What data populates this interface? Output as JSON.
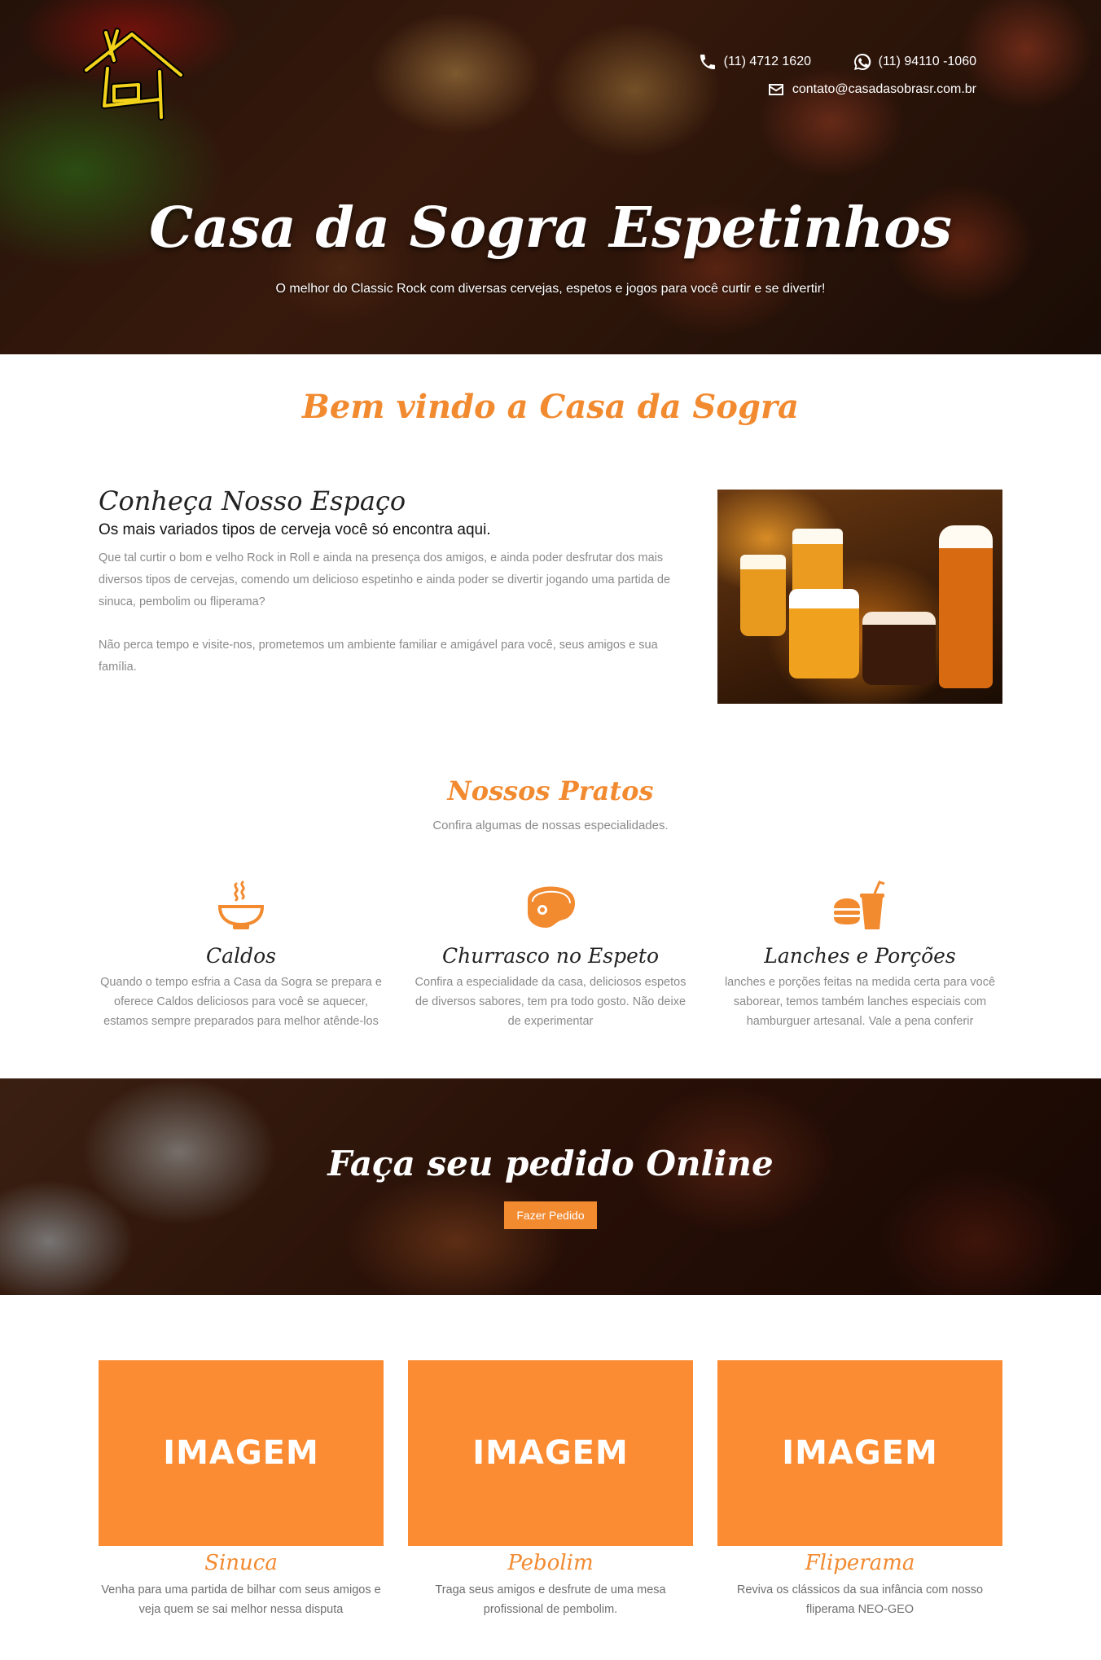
{
  "header": {
    "phone": "(11) 4712 1620",
    "whatsapp": "(11) 94110 -1060",
    "email": "contato@casadasobrasr.com.br",
    "title": "Casa da Sogra Espetinhos",
    "subtitle": "O melhor do Classic Rock com diversas cervejas, espetos e jogos para você curtir e se divertir!"
  },
  "welcome": {
    "title": "Bem vindo a Casa da Sogra"
  },
  "about": {
    "title": "Conheça Nosso Espaço",
    "subtitle": "Os mais variados tipos de cerveja você só encontra aqui.",
    "paragraph1": "Que tal curtir o bom e velho Rock in Roll e ainda na presença dos amigos, e ainda poder desfrutar dos mais diversos tipos de cervejas, comendo um delicioso espetinho e ainda poder se divertir jogando uma partida de sinuca, pembolim ou fliperama?",
    "paragraph2": "Não perca tempo e visite-nos, prometemos um ambiente familiar e amigável para você, seus amigos e sua família."
  },
  "dishes": {
    "title": "Nossos Pratos",
    "subtitle": "Confira algumas de nossas especialidades.",
    "items": [
      {
        "icon": "soup-bowl-icon",
        "title": "Caldos",
        "text": "Quando o tempo esfria a Casa da Sogra se prepara e oferece Caldos deliciosos para você se aquecer, estamos sempre preparados para melhor atênde-los"
      },
      {
        "icon": "steak-icon",
        "title": "Churrasco no Espeto",
        "text": "Confira a especialidade da casa, deliciosos espetos de diversos sabores, tem pra todo gosto. Não deixe de experimentar"
      },
      {
        "icon": "burger-drink-icon",
        "title": "Lanches e Porções",
        "text": "lanches e porções feitas na medida certa para você saborear, temos também lanches especiais com hamburguer artesanal. Vale a pena conferir"
      }
    ]
  },
  "order": {
    "title": "Faça seu pedido Online",
    "button": "Fazer Pedido"
  },
  "activities": {
    "placeholder": "IMAGEM",
    "items": [
      {
        "title": "Sinuca",
        "text": "Venha para uma partida de bilhar com seus amigos e veja quem se sai melhor nessa disputa"
      },
      {
        "title": "Pebolim",
        "text": "Traga seus amigos e desfrute de uma mesa profissional de pembolim."
      },
      {
        "title": "Fliperama",
        "text": "Reviva os clássicos da sua infância com nosso fliperama NEO-GEO"
      }
    ]
  },
  "colors": {
    "accent": "#f28a30",
    "placeholder": "#fc8c33",
    "logo": "#f2d21a"
  }
}
